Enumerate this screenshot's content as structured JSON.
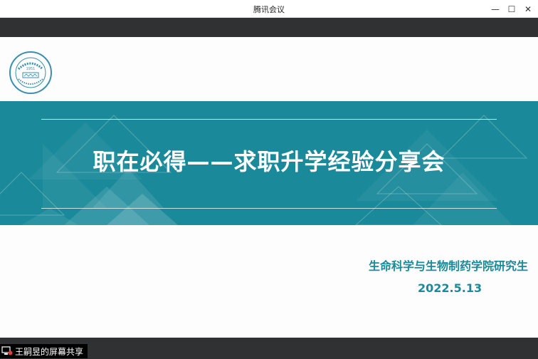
{
  "window": {
    "title": "腾讯会议",
    "controls": {
      "minimize": "—",
      "maximize": "☐",
      "close": "✕"
    }
  },
  "slide": {
    "title": "职在必得——求职升学经验分享会",
    "subtitle": "生命科学与生物制药学院研究生",
    "date": "2022.5.13",
    "logo_year": "1951",
    "colors": {
      "band": "#1a8a9a",
      "accent_text": "#1a8a9a",
      "title_text": "#ffffff"
    }
  },
  "screen_share": {
    "label": "王嗣昱的屏幕共享",
    "icon": "screen-share-icon"
  }
}
